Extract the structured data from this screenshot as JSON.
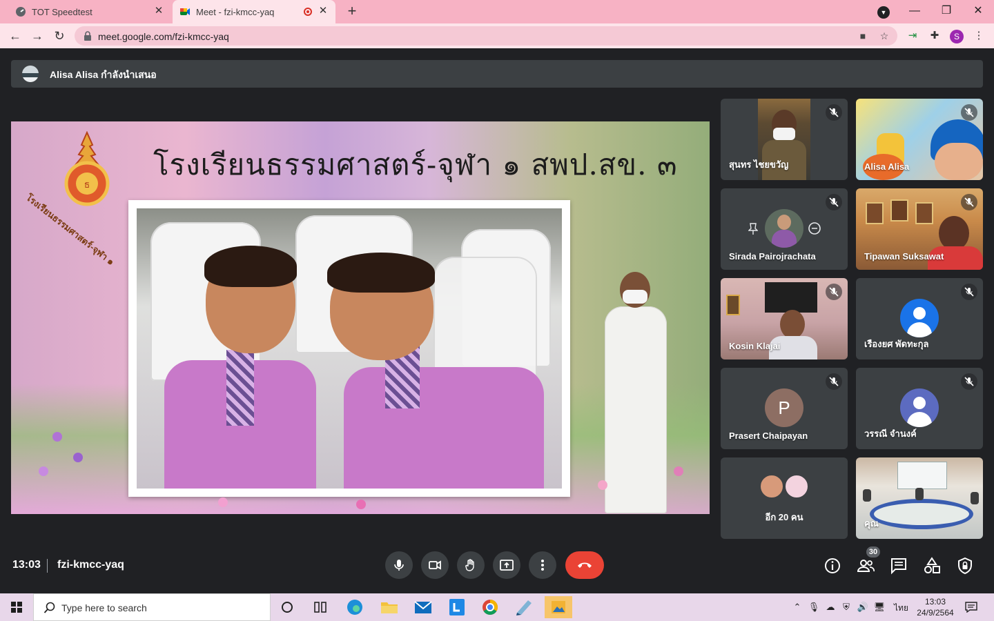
{
  "browser": {
    "tabs": [
      {
        "title": "TOT Speedtest",
        "icon": "speedtest-icon",
        "active": false
      },
      {
        "title": "Meet - fzi-kmcc-yaq",
        "icon": "google-meet-icon",
        "active": true,
        "recording": true
      }
    ],
    "url": "meet.google.com/fzi-kmcc-yaq",
    "profile_initial": "S"
  },
  "meet": {
    "presenter_text": "Alisa Alisa กำลังนำเสนอ",
    "presentation": {
      "banner_title": "โรงเรียนธรรมศาสตร์-จุฬา ๑ สพป.สข. ๓",
      "seal_caption": "โรงเรียนธรรมศาสตร์-จุฬา ๑"
    },
    "participants": [
      {
        "name": "สุนทร ไชยขวัญ",
        "type": "video",
        "muted": true
      },
      {
        "name": "Alisa Alisa",
        "type": "video",
        "muted": true
      },
      {
        "name": "Sirada Pairojrachata",
        "type": "photo",
        "muted": true
      },
      {
        "name": "Tipawan Suksawat",
        "type": "video",
        "muted": true
      },
      {
        "name": "Kosin Klajai",
        "type": "video",
        "muted": true
      },
      {
        "name": "เรืองยศ พัดทะกุล",
        "type": "avatar",
        "avatar_color": "#1a73e8",
        "muted": true
      },
      {
        "name": "Prasert Chaipayan",
        "type": "initial",
        "initial": "P",
        "avatar_color": "#8d6e63",
        "muted": true
      },
      {
        "name": "วรรณี จำนงค์",
        "type": "avatar",
        "avatar_color": "#5c6bc0",
        "muted": true
      },
      {
        "name": "อีก 20 คน",
        "type": "more"
      },
      {
        "name": "คุณ",
        "type": "video",
        "muted": false
      }
    ],
    "time": "13:03",
    "meeting_code": "fzi-kmcc-yaq",
    "participant_count": "30",
    "colors": {
      "end_call": "#ea4335",
      "dark_bg": "#202124",
      "tile_bg": "#3c4043"
    }
  },
  "taskbar": {
    "search_placeholder": "Type here to search",
    "language": "ไทย",
    "time": "13:03",
    "date": "24/9/2564"
  }
}
